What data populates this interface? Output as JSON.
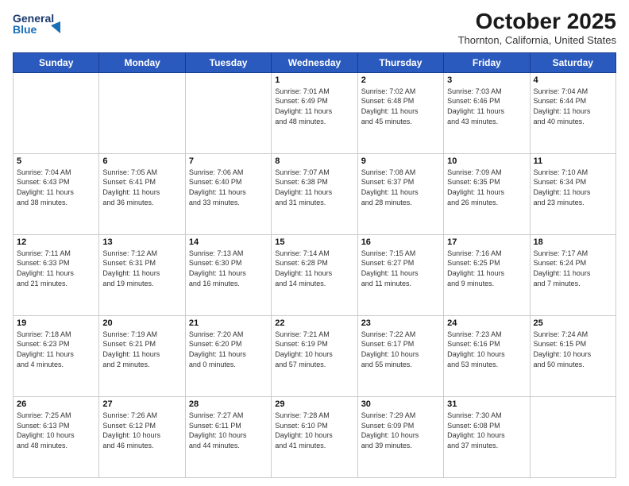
{
  "header": {
    "logo_line1": "General",
    "logo_line2": "Blue",
    "month": "October 2025",
    "location": "Thornton, California, United States"
  },
  "weekdays": [
    "Sunday",
    "Monday",
    "Tuesday",
    "Wednesday",
    "Thursday",
    "Friday",
    "Saturday"
  ],
  "weeks": [
    [
      {
        "day": "",
        "info": ""
      },
      {
        "day": "",
        "info": ""
      },
      {
        "day": "",
        "info": ""
      },
      {
        "day": "1",
        "info": "Sunrise: 7:01 AM\nSunset: 6:49 PM\nDaylight: 11 hours\nand 48 minutes."
      },
      {
        "day": "2",
        "info": "Sunrise: 7:02 AM\nSunset: 6:48 PM\nDaylight: 11 hours\nand 45 minutes."
      },
      {
        "day": "3",
        "info": "Sunrise: 7:03 AM\nSunset: 6:46 PM\nDaylight: 11 hours\nand 43 minutes."
      },
      {
        "day": "4",
        "info": "Sunrise: 7:04 AM\nSunset: 6:44 PM\nDaylight: 11 hours\nand 40 minutes."
      }
    ],
    [
      {
        "day": "5",
        "info": "Sunrise: 7:04 AM\nSunset: 6:43 PM\nDaylight: 11 hours\nand 38 minutes."
      },
      {
        "day": "6",
        "info": "Sunrise: 7:05 AM\nSunset: 6:41 PM\nDaylight: 11 hours\nand 36 minutes."
      },
      {
        "day": "7",
        "info": "Sunrise: 7:06 AM\nSunset: 6:40 PM\nDaylight: 11 hours\nand 33 minutes."
      },
      {
        "day": "8",
        "info": "Sunrise: 7:07 AM\nSunset: 6:38 PM\nDaylight: 11 hours\nand 31 minutes."
      },
      {
        "day": "9",
        "info": "Sunrise: 7:08 AM\nSunset: 6:37 PM\nDaylight: 11 hours\nand 28 minutes."
      },
      {
        "day": "10",
        "info": "Sunrise: 7:09 AM\nSunset: 6:35 PM\nDaylight: 11 hours\nand 26 minutes."
      },
      {
        "day": "11",
        "info": "Sunrise: 7:10 AM\nSunset: 6:34 PM\nDaylight: 11 hours\nand 23 minutes."
      }
    ],
    [
      {
        "day": "12",
        "info": "Sunrise: 7:11 AM\nSunset: 6:33 PM\nDaylight: 11 hours\nand 21 minutes."
      },
      {
        "day": "13",
        "info": "Sunrise: 7:12 AM\nSunset: 6:31 PM\nDaylight: 11 hours\nand 19 minutes."
      },
      {
        "day": "14",
        "info": "Sunrise: 7:13 AM\nSunset: 6:30 PM\nDaylight: 11 hours\nand 16 minutes."
      },
      {
        "day": "15",
        "info": "Sunrise: 7:14 AM\nSunset: 6:28 PM\nDaylight: 11 hours\nand 14 minutes."
      },
      {
        "day": "16",
        "info": "Sunrise: 7:15 AM\nSunset: 6:27 PM\nDaylight: 11 hours\nand 11 minutes."
      },
      {
        "day": "17",
        "info": "Sunrise: 7:16 AM\nSunset: 6:25 PM\nDaylight: 11 hours\nand 9 minutes."
      },
      {
        "day": "18",
        "info": "Sunrise: 7:17 AM\nSunset: 6:24 PM\nDaylight: 11 hours\nand 7 minutes."
      }
    ],
    [
      {
        "day": "19",
        "info": "Sunrise: 7:18 AM\nSunset: 6:23 PM\nDaylight: 11 hours\nand 4 minutes."
      },
      {
        "day": "20",
        "info": "Sunrise: 7:19 AM\nSunset: 6:21 PM\nDaylight: 11 hours\nand 2 minutes."
      },
      {
        "day": "21",
        "info": "Sunrise: 7:20 AM\nSunset: 6:20 PM\nDaylight: 11 hours\nand 0 minutes."
      },
      {
        "day": "22",
        "info": "Sunrise: 7:21 AM\nSunset: 6:19 PM\nDaylight: 10 hours\nand 57 minutes."
      },
      {
        "day": "23",
        "info": "Sunrise: 7:22 AM\nSunset: 6:17 PM\nDaylight: 10 hours\nand 55 minutes."
      },
      {
        "day": "24",
        "info": "Sunrise: 7:23 AM\nSunset: 6:16 PM\nDaylight: 10 hours\nand 53 minutes."
      },
      {
        "day": "25",
        "info": "Sunrise: 7:24 AM\nSunset: 6:15 PM\nDaylight: 10 hours\nand 50 minutes."
      }
    ],
    [
      {
        "day": "26",
        "info": "Sunrise: 7:25 AM\nSunset: 6:13 PM\nDaylight: 10 hours\nand 48 minutes."
      },
      {
        "day": "27",
        "info": "Sunrise: 7:26 AM\nSunset: 6:12 PM\nDaylight: 10 hours\nand 46 minutes."
      },
      {
        "day": "28",
        "info": "Sunrise: 7:27 AM\nSunset: 6:11 PM\nDaylight: 10 hours\nand 44 minutes."
      },
      {
        "day": "29",
        "info": "Sunrise: 7:28 AM\nSunset: 6:10 PM\nDaylight: 10 hours\nand 41 minutes."
      },
      {
        "day": "30",
        "info": "Sunrise: 7:29 AM\nSunset: 6:09 PM\nDaylight: 10 hours\nand 39 minutes."
      },
      {
        "day": "31",
        "info": "Sunrise: 7:30 AM\nSunset: 6:08 PM\nDaylight: 10 hours\nand 37 minutes."
      },
      {
        "day": "",
        "info": ""
      }
    ]
  ]
}
